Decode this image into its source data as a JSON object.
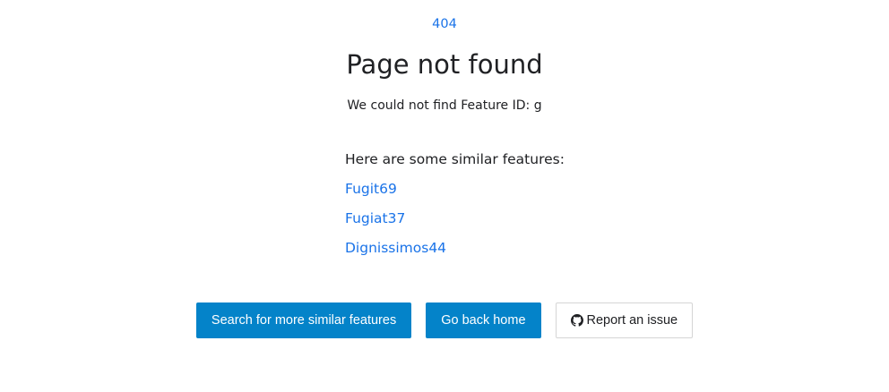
{
  "error": {
    "code": "404",
    "title": "Page not found",
    "message": "We could not find Feature ID: g"
  },
  "similar": {
    "heading": "Here are some similar features:",
    "items": [
      "Fugit69",
      "Fugiat37",
      "Dignissimos44"
    ]
  },
  "actions": {
    "search_label": "Search for more similar features",
    "home_label": "Go back home",
    "report_label": "Report an issue"
  },
  "icons": {
    "report": "github-icon"
  },
  "colors": {
    "link": "#1a73e8",
    "primary_button": "#0483c9"
  }
}
